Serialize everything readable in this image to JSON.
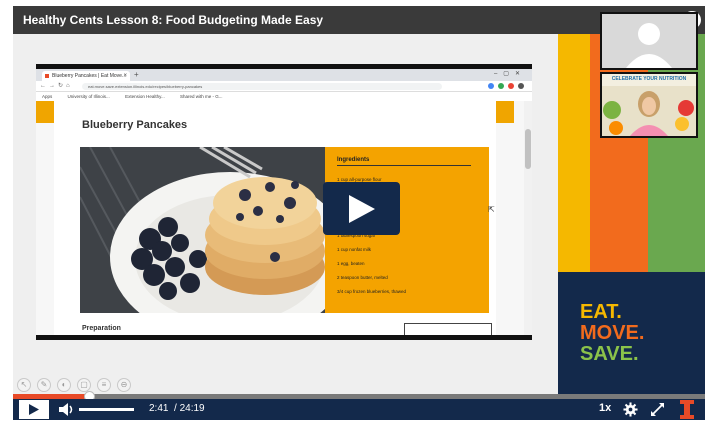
{
  "window": {
    "title": "Healthy Cents Lesson 8: Food Budgeting Made Easy",
    "info_label": "i"
  },
  "browser": {
    "tab_title": "Blueberry Pancakes | Eat Move...",
    "url": "eat.move.save.extension.illinois.edu/recipes/blueberry-pancakes",
    "bookmarks": [
      "Apps",
      "University of Illinois...",
      "Extension Healthy...",
      "Shared with me - G..."
    ]
  },
  "recipe": {
    "title": "Blueberry Pancakes",
    "ingredients_heading": "Ingredients",
    "ingredients": [
      "1 cup all-purpose flour",
      "1 tablespoon sugar",
      "2 teaspoons baking powder",
      "1/4 teaspoon salt",
      "1 tablespoon sugar",
      "1 cup nonfat milk",
      "1 egg, beaten",
      "2 teaspoon butter, melted",
      "3/4 cup frozen blueberries, thawed"
    ],
    "preparation_heading": "Preparation"
  },
  "webcam": {
    "banner": "CELEBRATE YOUR NUTRITION"
  },
  "sidebar": {
    "brand_lines": [
      "EAT.",
      "MOVE.",
      "SAVE."
    ]
  },
  "player": {
    "current_time": "2:41",
    "duration": "/ 24:19",
    "progress_fraction": 0.11,
    "speed": "1x"
  },
  "colors": {
    "navy": "#13294b",
    "orange": "#e84a27",
    "yellow": "#f5b800",
    "green": "#6aa84f"
  }
}
